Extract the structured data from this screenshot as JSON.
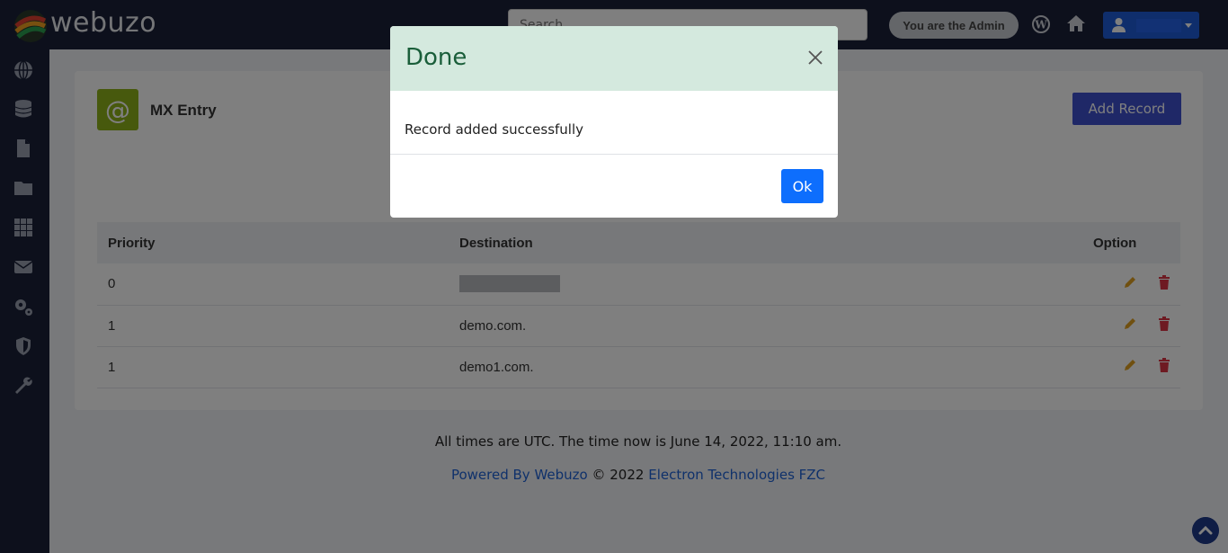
{
  "app": {
    "logo_text": "webuzo",
    "search_placeholder": "Search...",
    "admin_badge": "You are the Admin"
  },
  "sidebar": {
    "icons": [
      "globe-icon",
      "database-icon",
      "file-icon",
      "folder-icon",
      "apps-icon",
      "mail-icon",
      "settings-icon",
      "shield-icon",
      "wrench-icon"
    ]
  },
  "card": {
    "title": "MX Entry",
    "badge_symbol": "@",
    "add_record_label": "Add Record"
  },
  "table": {
    "headers": {
      "priority": "Priority",
      "destination": "Destination",
      "option": "Option"
    },
    "rows": [
      {
        "priority": "0",
        "destination": ""
      },
      {
        "priority": "1",
        "destination": "demo.com."
      },
      {
        "priority": "1",
        "destination": "demo1.com."
      }
    ]
  },
  "footer": {
    "time_text": "All times are UTC. The time now is June 14, 2022, 11:10 am.",
    "powered_by": "Powered By Webuzo",
    "copyright": "© 2022",
    "company": "Electron Technologies FZC"
  },
  "modal": {
    "title": "Done",
    "message": "Record added successfully",
    "ok_label": "Ok"
  },
  "colors": {
    "topbar": "#1a2138",
    "accent": "#3f51cf",
    "modal_header": "#d4e9de",
    "ok_button": "#0d6efd",
    "edit_icon": "#e0a020",
    "delete_icon": "#dc3545"
  }
}
